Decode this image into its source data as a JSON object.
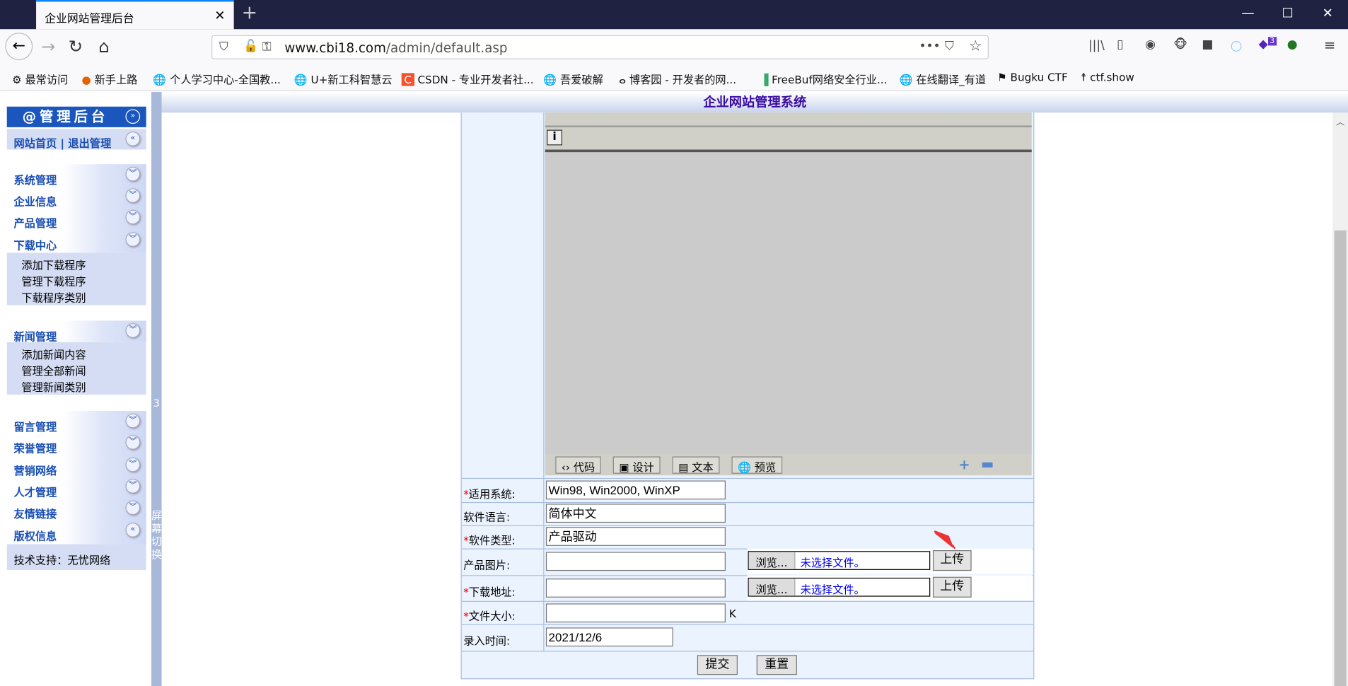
{
  "browser": {
    "tab_title": "企业网站管理后台",
    "url_domain": "www.cbi18.com",
    "url_path": "/admin/default.asp",
    "bookmarks": [
      "最常访问",
      "新手上路",
      "个人学习中心-全国教...",
      "U+新工科智慧云",
      "CSDN - 专业开发者社...",
      "吾爱破解",
      "博客园 - 开发者的网...",
      "FreeBuf网络安全行业...",
      "在线翻译_有道",
      "Bugku CTF",
      "ctf.show"
    ],
    "extension_badge": "3"
  },
  "header": {
    "title": "企业网站管理系统"
  },
  "sidebar": {
    "title": "@管理后台",
    "home_link": "网站首页",
    "logout_link": "退出管理",
    "groups1": [
      "系统管理",
      "企业信息",
      "产品管理",
      "下载中心"
    ],
    "download_items": [
      "添加下载程序",
      "管理下载程序",
      "下载程序类别"
    ],
    "news_group": "新闻管理",
    "news_items": [
      "添加新闻内容",
      "管理全部新闻",
      "管理新闻类别"
    ],
    "groups2": [
      "留言管理",
      "荣誉管理",
      "营销网络",
      "人才管理",
      "友情链接",
      "版权信息"
    ],
    "support": "技术支持：无忧网络"
  },
  "divider": {
    "num": "3",
    "label": "屏幕切换"
  },
  "editor": {
    "modes": [
      "代码",
      "设计",
      "文本",
      "预览"
    ]
  },
  "form": {
    "os_label": "适用系统:",
    "os_value": "Win98, Win2000, WinXP",
    "lang_label": "软件语言:",
    "lang_value": "简体中文",
    "type_label": "软件类型:",
    "type_value": "产品驱动",
    "image_label": "产品图片:",
    "download_label": "下载地址:",
    "size_label": "文件大小:",
    "size_unit": "K",
    "date_label": "录入时间:",
    "date_value": "2021/12/6",
    "browse": "浏览...",
    "no_file": "未选择文件。",
    "upload": "上传",
    "submit": "提交",
    "reset": "重置"
  }
}
